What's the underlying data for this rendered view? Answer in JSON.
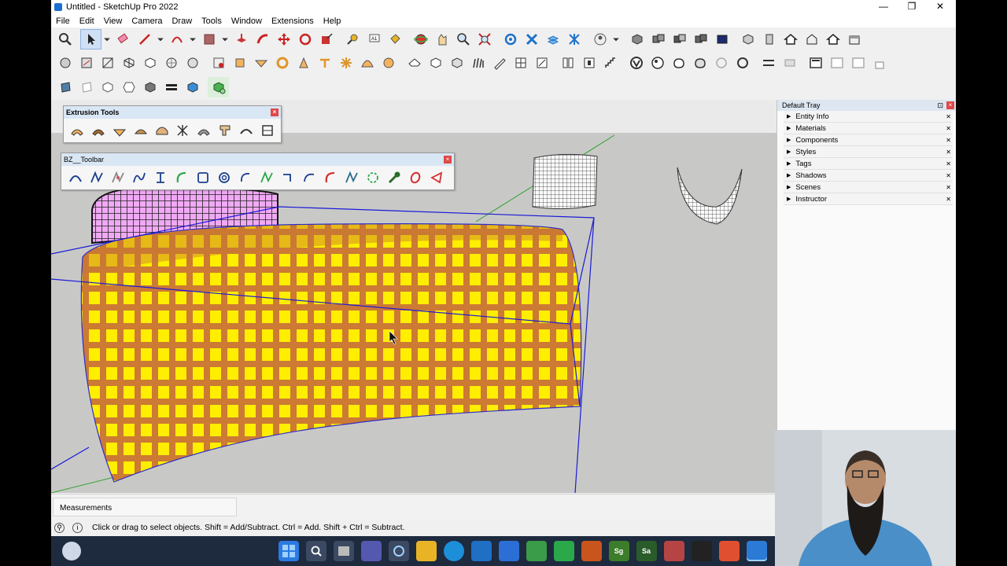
{
  "window": {
    "title": "Untitled - SketchUp Pro 2022",
    "minimize": "—",
    "restore": "❐",
    "close": "✕"
  },
  "menu": [
    "File",
    "Edit",
    "View",
    "Camera",
    "Draw",
    "Tools",
    "Window",
    "Extensions",
    "Help"
  ],
  "floating_toolbars": {
    "extrusion": {
      "title": "Extrusion Tools",
      "close": "×"
    },
    "bz": {
      "title": "BZ__Toolbar",
      "close": "×"
    }
  },
  "tray": {
    "title": "Default Tray",
    "pin": "⊡",
    "close": "×",
    "items": [
      {
        "label": "Entity Info"
      },
      {
        "label": "Materials"
      },
      {
        "label": "Components"
      },
      {
        "label": "Styles"
      },
      {
        "label": "Tags"
      },
      {
        "label": "Shadows"
      },
      {
        "label": "Scenes"
      },
      {
        "label": "Instructor"
      }
    ]
  },
  "measurements": {
    "label": "Measurements"
  },
  "status": {
    "message": "Click or drag to select objects. Shift = Add/Subtract. Ctrl = Add. Shift + Ctrl = Subtract."
  },
  "taskbar": {
    "apps": [
      {
        "name": "windows-start",
        "label": "",
        "color": "#2a7ae2"
      },
      {
        "name": "search",
        "label": "",
        "color": "#3b4a62"
      },
      {
        "name": "task-view",
        "label": "",
        "color": "#3b4a62"
      },
      {
        "name": "teams",
        "label": "",
        "color": "#5558af"
      },
      {
        "name": "cortana",
        "label": "",
        "color": "#3b4a62"
      },
      {
        "name": "file-explorer",
        "label": "",
        "color": "#e8b425"
      },
      {
        "name": "edge",
        "label": "",
        "color": "#1d8fd8"
      },
      {
        "name": "visual-studio-code",
        "label": "",
        "color": "#1f6fc4"
      },
      {
        "name": "store",
        "label": "",
        "color": "#2b6fd6"
      },
      {
        "name": "photos",
        "label": "",
        "color": "#3a9b48"
      },
      {
        "name": "camtasia",
        "label": "",
        "color": "#2aa84a"
      },
      {
        "name": "autocad",
        "label": "",
        "color": "#c8551c"
      },
      {
        "name": "sg",
        "label": "Sg",
        "color": "#3b7d2a"
      },
      {
        "name": "sa",
        "label": "Sa",
        "color": "#2a5c2a"
      },
      {
        "name": "scrabble",
        "label": "",
        "color": "#b64444"
      },
      {
        "name": "unreal",
        "label": "",
        "color": "#222"
      },
      {
        "name": "camtasia-recorder",
        "label": "",
        "color": "#e04f2f"
      },
      {
        "name": "sketchup",
        "label": "",
        "color": "#2b7bd6"
      }
    ]
  },
  "colors": {
    "selection": "#1a1ad8",
    "face": "#ffee00",
    "frame_edge": "#c8762a",
    "axis_green": "#31a131"
  }
}
